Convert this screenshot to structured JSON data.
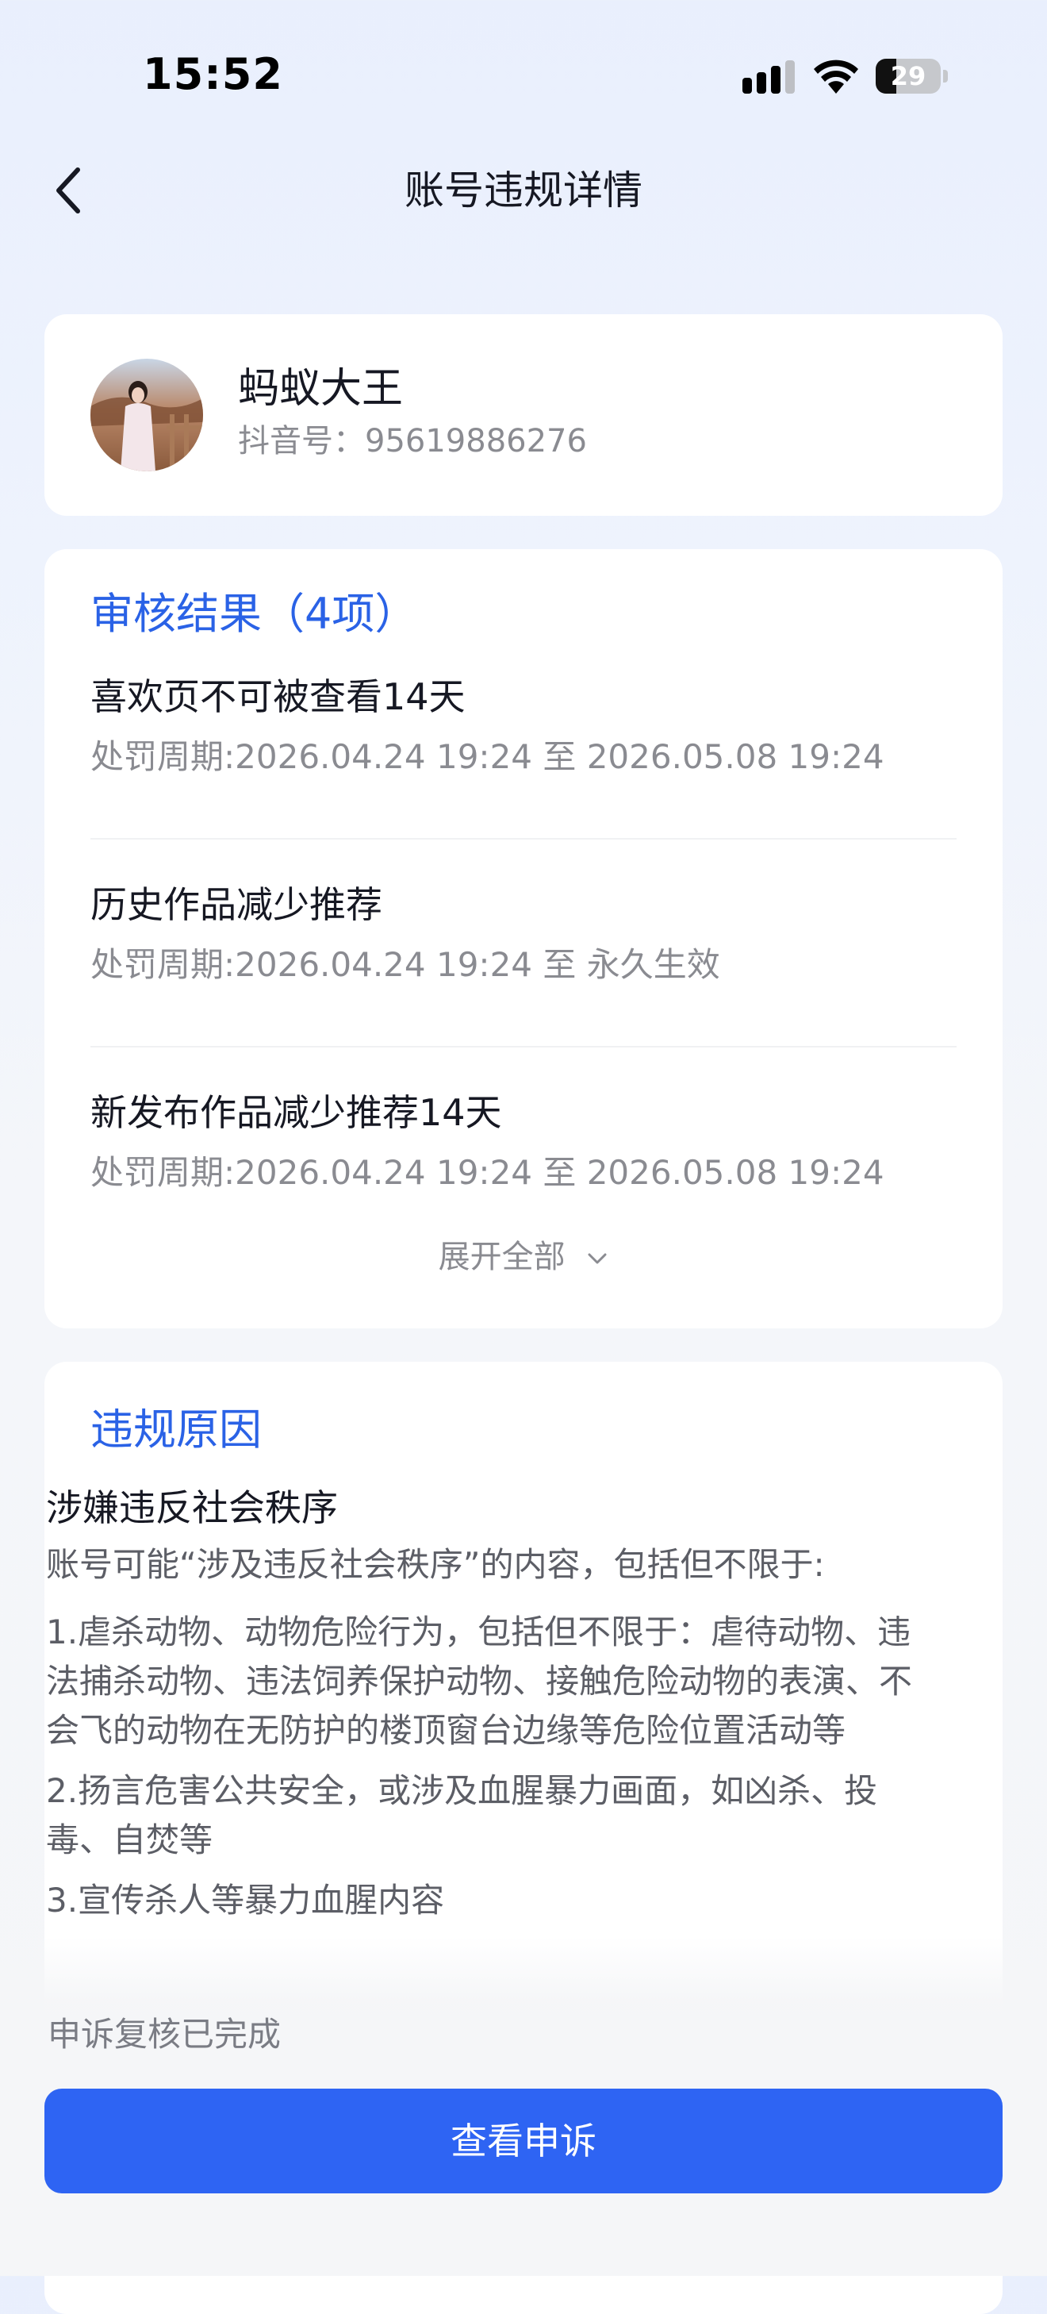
{
  "status_bar": {
    "time": "15:52",
    "battery_level": "29",
    "icons": [
      "signal-icon",
      "wifi-icon",
      "battery-icon"
    ]
  },
  "nav": {
    "title": "账号违规详情",
    "back_icon": "chevron-left-icon"
  },
  "profile": {
    "name": "蚂蚁大王",
    "id_label": "抖音号：95619886276"
  },
  "review": {
    "title": "审核结果（4项）",
    "items": [
      {
        "name": "喜欢页不可被查看14天",
        "period": "处罚周期:2026.04.24 19:24 至 2026.05.08 19:24"
      },
      {
        "name": "历史作品减少推荐",
        "period": "处罚周期:2026.04.24 19:24 至 永久生效"
      },
      {
        "name": "新发布作品减少推荐14天",
        "period": "处罚周期:2026.04.24 19:24 至 2026.05.08 19:24"
      }
    ],
    "expand_label": "展开全部"
  },
  "violation": {
    "title": "违规原因",
    "reason_title": "涉嫌违反社会秩序",
    "reason_desc": "账号可能“涉及违反社会秩序”的内容，包括但不限于:",
    "items": [
      "1.虐杀动物、动物危险行为，包括但不限于：虐待动物、违法捕杀动物、违法饲养保护动物、接触危险动物的表演、不会飞的动物在无防护的楼顶窗台边缘等危险位置活动等",
      "2.扬言危害公共安全，或涉及血腥暴力画面，如凶杀、投毒、自焚等",
      "3.宣传杀人等暴力血腥内容"
    ]
  },
  "footer": {
    "appeal_status": "申诉复核已完成",
    "appeal_button": "查看申诉"
  },
  "colors": {
    "accent_blue": "#2a62e6",
    "button_blue": "#2e64f3",
    "text_primary": "#161823",
    "text_secondary": "#8a8b91"
  }
}
